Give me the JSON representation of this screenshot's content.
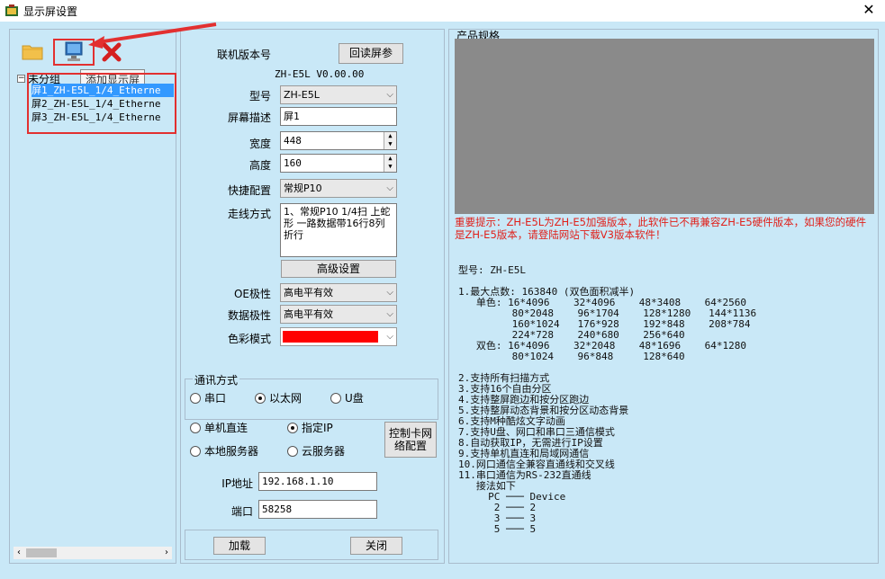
{
  "window": {
    "title": "显示屏设置",
    "close_symbol": "✕"
  },
  "left": {
    "tooltip": "添加显示屏",
    "tree_root": "未分组",
    "tree_expander": "−",
    "items": [
      "屏1_ZH-E5L_1/4_Etherne",
      "屏2_ZH-E5L_1/4_Etherne",
      "屏3_ZH-E5L_1/4_Etherne"
    ],
    "scroll_left": "‹",
    "scroll_right": "›"
  },
  "mid": {
    "version_label": "联机版本号",
    "readback_button": "回读屏参",
    "version_value": "ZH-E5L V0.00.00",
    "model_label": "型号",
    "model_value": "ZH-E5L",
    "desc_label": "屏幕描述",
    "desc_value": "屏1",
    "width_label": "宽度",
    "width_value": "448",
    "height_label": "高度",
    "height_value": "160",
    "quick_label": "快捷配置",
    "quick_value": "常规P10",
    "routing_label": "走线方式",
    "routing_value": "1、常规P10  1/4扫 上蛇形 一路数据带16行8列折行",
    "advanced_button": "高级设置",
    "oe_label": "OE极性",
    "oe_value": "高电平有效",
    "data_label": "数据极性",
    "data_value": "高电平有效",
    "color_label": "色彩模式",
    "color_swatch": "#ff0000",
    "comm_group": "通讯方式",
    "comm_options": [
      "串口",
      "以太网",
      "U盘"
    ],
    "mode_options": [
      "单机直连",
      "指定IP",
      "本地服务器",
      "云服务器"
    ],
    "network_button_line1": "控制卡网",
    "network_button_line2": "络配置",
    "ip_label": "IP地址",
    "ip_value": "192.168.1.10",
    "port_label": "端口",
    "port_value": "58258",
    "load_button": "加载",
    "close_button": "关闭"
  },
  "right": {
    "title": "产品规格",
    "warning": "重要提示：ZH-E5L为ZH-E5加强版本，此软件已不再兼容ZH-E5硬件版本，如果您的硬件是ZH-E5版本，请登陆网站下载V3版本软件！",
    "specs": [
      "型号: ZH-E5L",
      "",
      "1.最大点数: 163840 (双色面积减半)",
      "   单色: 16*4096    32*4096    48*3408    64*2560",
      "         80*2048    96*1704    128*1280   144*1136",
      "         160*1024   176*928    192*848    208*784",
      "         224*728    240*680    256*640",
      "   双色: 16*4096    32*2048    48*1696    64*1280",
      "         80*1024    96*848     128*640",
      "",
      "2.支持所有扫描方式",
      "3.支持16个自由分区",
      "4.支持整屏跑边和按分区跑边",
      "5.支持整屏动态背景和按分区动态背景",
      "6.支持M种酷炫文字动画",
      "7.支持U盘、网口和串口三通信模式",
      "8.自动获取IP，无需进行IP设置",
      "9.支持单机直连和局域网通信",
      "10.网口通信全兼容直通线和交叉线",
      "11.串口通信为RS-232直通线",
      "   接法如下",
      "     PC ─── Device",
      "      2 ─── 2",
      "      3 ─── 3",
      "      5 ─── 5"
    ]
  },
  "colors": {
    "accent_red": "#e23030",
    "panel_bg": "#c9e8f7",
    "selection": "#3399ff"
  }
}
